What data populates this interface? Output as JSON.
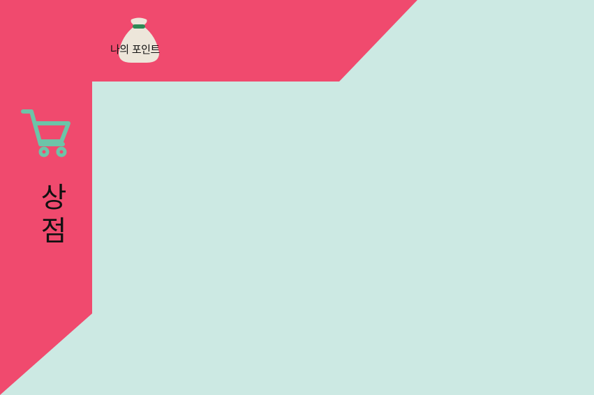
{
  "colors": {
    "background": "#cce9e3",
    "accent": "#f04a6e",
    "icon_teal": "#6cc4a8",
    "bag_fill": "#ede6da",
    "bag_tie": "#2e8a55",
    "text": "#111111"
  },
  "points": {
    "label": "나의 포인트",
    "icon": "money-bag-icon"
  },
  "shop": {
    "label": "상점",
    "icon": "shopping-cart-icon"
  }
}
